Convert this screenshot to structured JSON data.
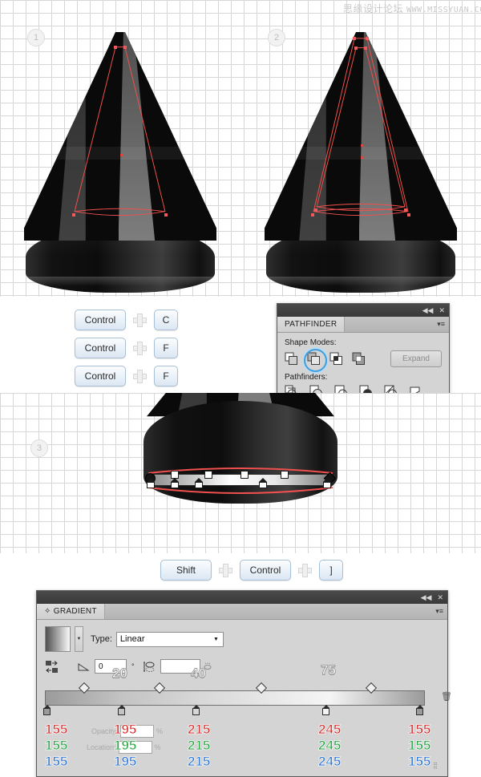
{
  "watermark": {
    "cn": "思缘设计论坛",
    "url": "WWW.MISSYUAN.COM"
  },
  "steps": [
    {
      "number": "1"
    },
    {
      "number": "2"
    },
    {
      "number": "3"
    }
  ],
  "shortcuts": {
    "plus_symbol": "+",
    "group_a": [
      {
        "keys": [
          "Control",
          "C"
        ]
      },
      {
        "keys": [
          "Control",
          "F"
        ]
      },
      {
        "keys": [
          "Control",
          "F"
        ]
      }
    ],
    "group_b": [
      {
        "keys": [
          "Shift",
          "Control",
          "]"
        ]
      }
    ]
  },
  "pathfinder_panel": {
    "title": "PATHFINDER",
    "collapse_icon": "◀◀",
    "close_icon": "✕",
    "menu_icon": "▾≡",
    "shape_modes_label": "Shape Modes:",
    "pathfinders_label": "Pathfinders:",
    "expand_label": "Expand",
    "shape_modes": [
      {
        "name": "unite",
        "selected": false
      },
      {
        "name": "minus-front",
        "selected": true
      },
      {
        "name": "intersect",
        "selected": false
      },
      {
        "name": "exclude",
        "selected": false
      }
    ],
    "pathfinder_modes": [
      {
        "name": "divide"
      },
      {
        "name": "trim"
      },
      {
        "name": "merge"
      },
      {
        "name": "crop"
      },
      {
        "name": "outline"
      },
      {
        "name": "minus-back"
      }
    ]
  },
  "gradient_panel": {
    "title": "GRADIENT",
    "collapse_icon": "◀◀",
    "close_icon": "✕",
    "menu_icon": "▾≡",
    "dock_icon": "✧",
    "type_label": "Type:",
    "type_value": "Linear",
    "type_arrow": "▼",
    "angle_label": "°",
    "angle_value": "0",
    "aspect_value": "",
    "reverse_icon": "reverse-gradient-icon",
    "delete_icon": "🗑",
    "opacity_label": "Opacity:",
    "opacity_value": "",
    "location_label": "Location:",
    "location_value": "",
    "percent_symbol": "%",
    "midpoint_labels": [
      "20",
      "40",
      "75"
    ],
    "stops": [
      {
        "location_pct": 0,
        "r": "155",
        "g": "155",
        "b": "155"
      },
      {
        "location_pct": 20,
        "r": "195",
        "g": "195",
        "b": "195"
      },
      {
        "location_pct": 40,
        "r": "215",
        "g": "215",
        "b": "215"
      },
      {
        "location_pct": 75,
        "r": "245",
        "g": "245",
        "b": "245"
      },
      {
        "location_pct": 100,
        "r": "155",
        "g": "155",
        "b": "155"
      }
    ],
    "midpoints_pct": [
      10,
      30,
      57,
      87
    ]
  },
  "colors": {
    "selection_red": "#f0504d",
    "highlight_blue": "#3e9fe0",
    "panel_bg": "#d4d4d4",
    "cone_black": "#0a0a0a"
  }
}
